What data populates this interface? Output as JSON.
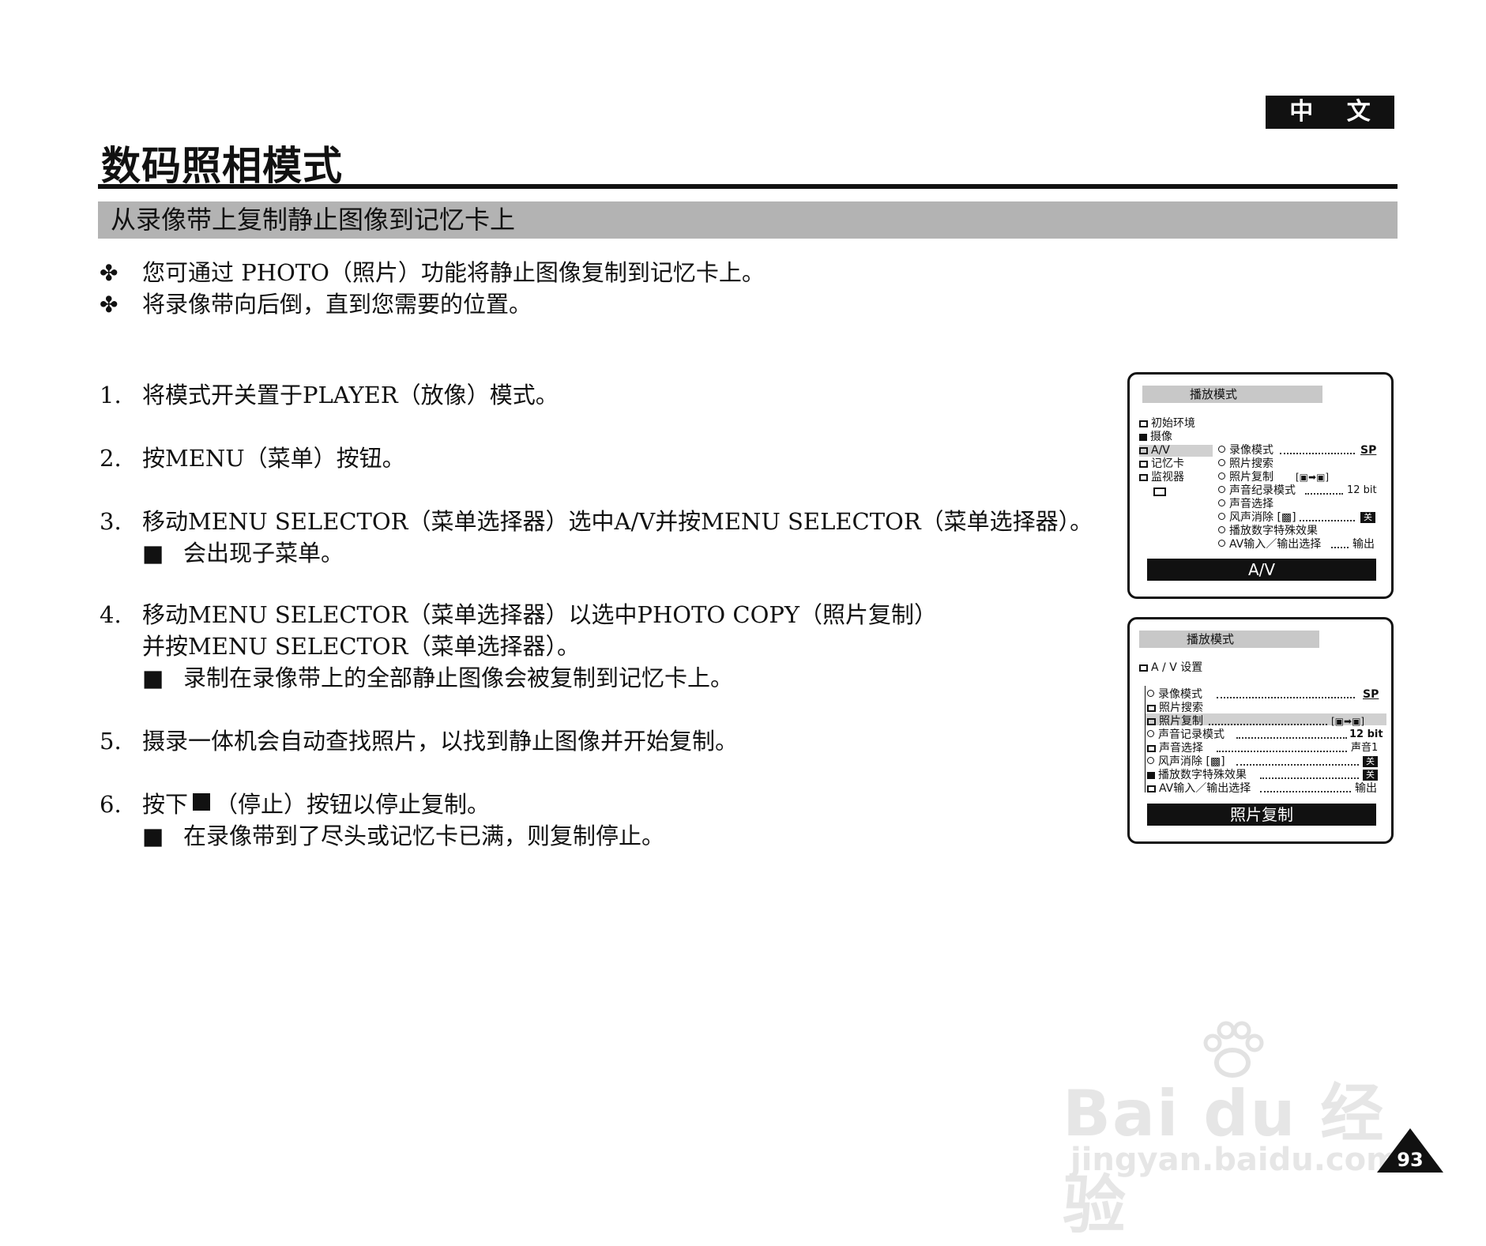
{
  "lang_tag": "中 文",
  "page_title": "数码照相模式",
  "section_title": "从录像带上复制静止图像到记忆卡上",
  "intro_bullets": [
    "您可通过 PHOTO（照片）功能将静止图像复制到记忆卡上。",
    "将录像带向后倒，直到您需要的位置。"
  ],
  "bullet_mark": "✤",
  "sub_mark": "■",
  "steps": [
    {
      "num": "1.",
      "text": "将模式开关置于PLAYER（放像）模式。"
    },
    {
      "num": "2.",
      "text": "按MENU（菜单）按钮。"
    },
    {
      "num": "3.",
      "text": "移动MENU SELECTOR（菜单选择器）选中A/V并按MENU SELECTOR（菜单选择器）。",
      "sub": "会出现子菜单。"
    },
    {
      "num": "4.",
      "text": "移动MENU SELECTOR（菜单选择器）以选中PHOTO COPY（照片复制）",
      "cont": "并按MENU SELECTOR（菜单选择器）。",
      "sub": "录制在录像带上的全部静止图像会被复制到记忆卡上。"
    },
    {
      "num": "5.",
      "text": "摄录一体机会自动查找照片，以找到静止图像并开始复制。"
    },
    {
      "num": "6.",
      "text_before": "按下",
      "text_after": "（停止）按钮以停止复制。",
      "sub": "在录像带到了尽头或记忆卡已满，则复制停止。"
    }
  ],
  "lcd1": {
    "header": "播放模式",
    "left_menu": [
      "初始环境",
      "摄像",
      "A/V",
      "记忆卡",
      "监视器"
    ],
    "right_menu": [
      "录像模式",
      "照片搜索",
      "照片复制",
      "声音纪录模式",
      "声音选择",
      "风声消除",
      "播放数字特殊效果",
      "AV输入／输出选择"
    ],
    "values": {
      "rec_mode": "SP",
      "photo_copy": "[▣➡▣]",
      "sound_mode": "12 bit",
      "wind": "关",
      "av": "输出"
    },
    "footer": "A/V"
  },
  "lcd2": {
    "header": "播放模式",
    "subtitle": "A / V 设置",
    "items": [
      "录像模式",
      "照片搜索",
      "照片复制",
      "声音记录模式",
      "声音选择",
      "风声消除",
      "播放数字特殊效果",
      "AV输入／输出选择"
    ],
    "values": {
      "rec_mode": "SP",
      "photo_copy": "[▣➡▣]",
      "sound_mode": "12 bit",
      "sound_sel": "声音1",
      "wind": "关",
      "dse": "关",
      "av": "输出"
    },
    "footer": "照片复制"
  },
  "page_number": "93",
  "watermark": {
    "brand": "Bai du 经验",
    "url": "jingyan.baidu.com"
  }
}
